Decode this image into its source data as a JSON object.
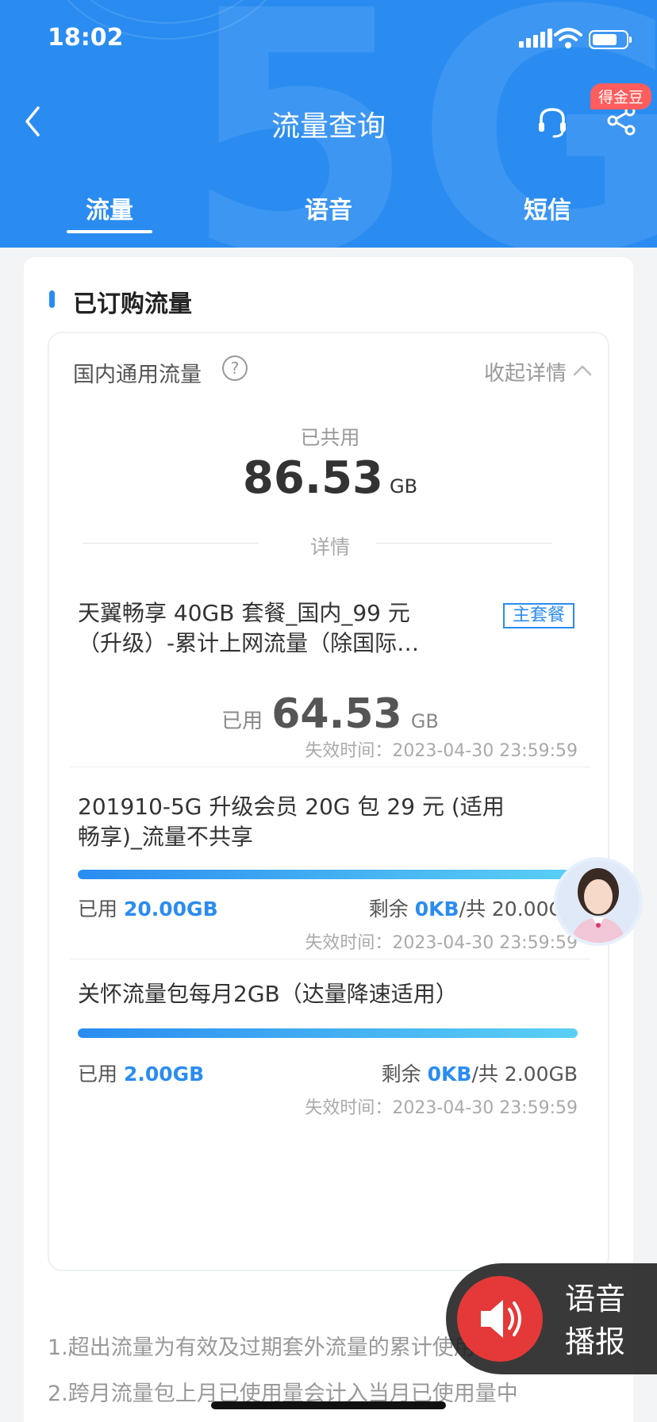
{
  "status_bar": {
    "time": "18:02"
  },
  "header": {
    "title": "流量查询",
    "coin_badge": "得金豆"
  },
  "tabs": [
    {
      "label": "流量",
      "active": true
    },
    {
      "label": "语音",
      "active": false
    },
    {
      "label": "短信",
      "active": false
    }
  ],
  "section": {
    "title": "已订购流量"
  },
  "domestic": {
    "label": "国内通用流量",
    "help_icon": "?",
    "collapse_label": "收起详情",
    "shared_label": "已共用",
    "shared_value": "86.53",
    "shared_unit": "GB",
    "detail_label": "详情"
  },
  "packages": [
    {
      "name_line1": "天翼畅享 40GB 套餐_国内_99 元",
      "name_line2": "（升级）-累计上网流量（除国际…",
      "badge": "主套餐",
      "used_label": "已用",
      "used_value": "64.53",
      "used_unit": "GB",
      "expiry": "失效时间：2023-04-30 23:59:59"
    },
    {
      "name_line1": "201910-5G 升级会员 20G 包 29 元 (适用",
      "name_line2": "畅享)_流量不共享",
      "used_fraction": 1.0,
      "used_label": "已用",
      "used_value": "20.00GB",
      "remain_label": "剩余",
      "remain_value": "0KB",
      "total_label": "/共 20.00GB",
      "expiry": "失效时间：2023-04-30 23:59:59"
    },
    {
      "name_line1": "关怀流量包每月2GB（达量降速适用）",
      "used_fraction": 1.0,
      "used_label": "已用",
      "used_value": "2.00GB",
      "remain_label": "剩余",
      "remain_value": "0KB",
      "total_label": "/共 2.00GB",
      "expiry": "失效时间：2023-04-30 23:59:59"
    }
  ],
  "notes": [
    "1.超出流量为有效及过期套外流量的累计使用量",
    "2.跨月流量包上月已使用量会计入当月已使用量中"
  ],
  "voice_broadcast": {
    "label": "语音播报"
  },
  "colors": {
    "primary": "#2a8cf0",
    "badge_red": "#ff5d5d",
    "voice_red": "#e53838"
  }
}
